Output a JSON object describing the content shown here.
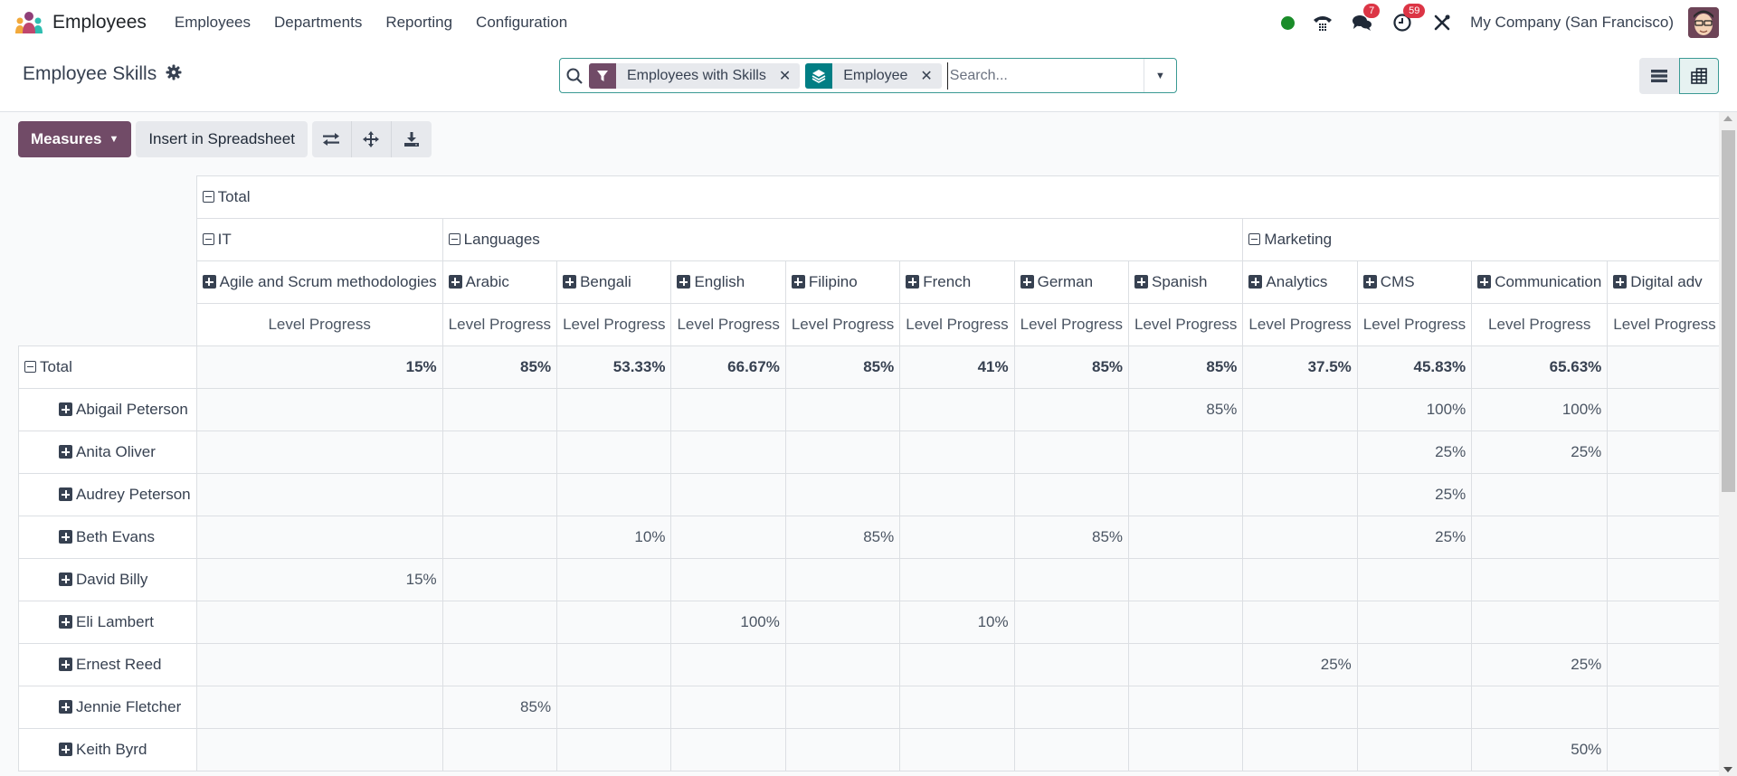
{
  "navbar": {
    "app_name": "Employees",
    "menu": [
      "Employees",
      "Departments",
      "Reporting",
      "Configuration"
    ],
    "messages_badge": "7",
    "activities_badge": "59",
    "company": "My Company (San Francisco)",
    "status_color": "#1a8c29"
  },
  "control_panel": {
    "title": "Employee Skills",
    "search": {
      "facets": [
        {
          "icon": "filter-icon",
          "label": "Employees with Skills",
          "color": "#714b67"
        },
        {
          "icon": "group-by-icon",
          "label": "Employee",
          "color": "#017e84"
        }
      ],
      "placeholder": "Search..."
    },
    "views": [
      "list-view",
      "pivot-view"
    ],
    "active_view": "pivot-view"
  },
  "toolbar": {
    "measures_label": "Measures",
    "insert_label": "Insert in Spreadsheet",
    "flip_axis": "flip-axis-icon",
    "expand_all": "expand-all-icon",
    "download": "download-icon"
  },
  "pivot": {
    "col_total_label": "Total",
    "groups": [
      {
        "label": "IT",
        "span": 1
      },
      {
        "label": "Languages",
        "span": 7
      },
      {
        "label": "Marketing",
        "span": 4
      }
    ],
    "skills": [
      "Agile and Scrum methodologies",
      "Arabic",
      "Bengali",
      "English",
      "Filipino",
      "French",
      "German",
      "Spanish",
      "Analytics",
      "CMS",
      "Communication",
      "Digital adv"
    ],
    "measure_label": "Level Progress",
    "row_total_label": "Total",
    "totals": [
      "15%",
      "85%",
      "53.33%",
      "66.67%",
      "85%",
      "41%",
      "85%",
      "85%",
      "37.5%",
      "45.83%",
      "65.63%",
      ""
    ],
    "rows": [
      {
        "name": "Abigail Peterson",
        "values": [
          "",
          "",
          "",
          "",
          "",
          "",
          "",
          "85%",
          "",
          "100%",
          "100%",
          ""
        ]
      },
      {
        "name": "Anita Oliver",
        "values": [
          "",
          "",
          "",
          "",
          "",
          "",
          "",
          "",
          "",
          "25%",
          "25%",
          ""
        ]
      },
      {
        "name": "Audrey Peterson",
        "values": [
          "",
          "",
          "",
          "",
          "",
          "",
          "",
          "",
          "",
          "25%",
          "",
          ""
        ]
      },
      {
        "name": "Beth Evans",
        "values": [
          "",
          "",
          "10%",
          "",
          "85%",
          "",
          "85%",
          "",
          "",
          "25%",
          "",
          ""
        ]
      },
      {
        "name": "David Billy",
        "values": [
          "15%",
          "",
          "",
          "",
          "",
          "",
          "",
          "",
          "",
          "",
          "",
          ""
        ]
      },
      {
        "name": "Eli Lambert",
        "values": [
          "",
          "",
          "",
          "100%",
          "",
          "10%",
          "",
          "",
          "",
          "",
          "",
          ""
        ]
      },
      {
        "name": "Ernest Reed",
        "values": [
          "",
          "",
          "",
          "",
          "",
          "",
          "",
          "",
          "25%",
          "",
          "25%",
          ""
        ]
      },
      {
        "name": "Jennie Fletcher",
        "values": [
          "",
          "85%",
          "",
          "",
          "",
          "",
          "",
          "",
          "",
          "",
          "",
          ""
        ]
      },
      {
        "name": "Keith Byrd",
        "values": [
          "",
          "",
          "",
          "",
          "",
          "",
          "",
          "",
          "",
          "",
          "50%",
          ""
        ]
      }
    ]
  }
}
